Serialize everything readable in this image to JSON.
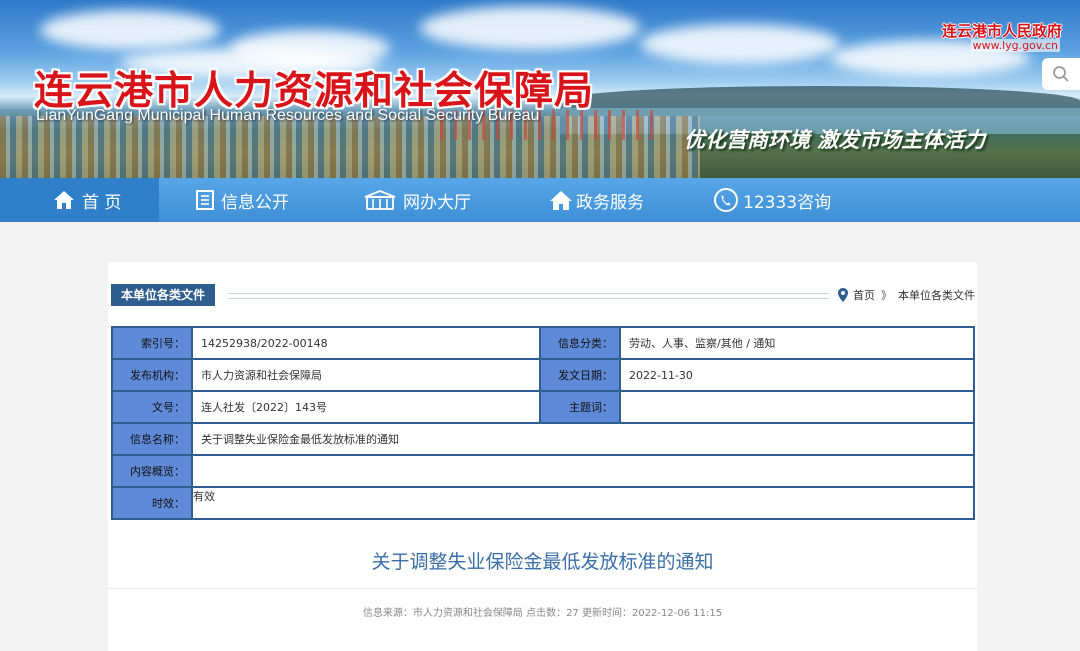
{
  "header": {
    "title_cn": "连云港市人力资源和社会保障局",
    "title_en": "LianYunGang Municipal Human Resources and Social Security Bureau",
    "slogan": "优化营商环境 激发市场主体活力",
    "gov_name": "连云港市人民政府",
    "gov_url": "www.lyg.gov.cn",
    "search_icon": "search-icon"
  },
  "nav": [
    {
      "label": "首 页",
      "icon": "home-icon"
    },
    {
      "label": "信息公开",
      "icon": "document-icon"
    },
    {
      "label": "网办大厅",
      "icon": "building-icon"
    },
    {
      "label": "政务服务",
      "icon": "house-icon"
    },
    {
      "label": "12333咨询",
      "icon": "phone-icon"
    }
  ],
  "section": {
    "heading": "本单位各类文件",
    "breadcrumb_home": "首页",
    "breadcrumb_sep": "》",
    "breadcrumb_current": "本单位各类文件"
  },
  "info": {
    "index_label": "索引号：",
    "index_value": "14252938/2022-00148",
    "category_label": "信息分类：",
    "category_value": "劳动、人事、监察/其他 / 通知",
    "publisher_label": "发布机构：",
    "publisher_value": "市人力资源和社会保障局",
    "date_label": "发文日期：",
    "date_value": "2022-11-30",
    "docno_label": "文号：",
    "docno_value": "连人社发〔2022〕143号",
    "subject_label": "主题词：",
    "subject_value": "",
    "name_label": "信息名称：",
    "name_value": "关于调整失业保险金最低发放标准的通知",
    "summary_label": "内容概览：",
    "summary_value": "",
    "validity_label": "时效：",
    "validity_value": "有效"
  },
  "article": {
    "title": "关于调整失业保险金最低发放标准的通知",
    "meta": "信息来源：市人力资源和社会保障局 点击数：27 更新时间：2022-12-06 11:15"
  }
}
